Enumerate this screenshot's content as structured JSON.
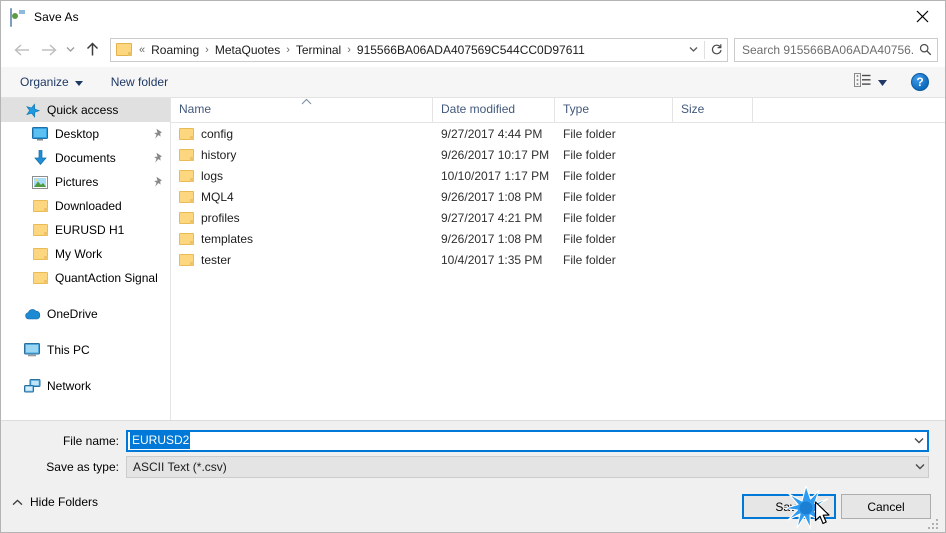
{
  "window": {
    "title": "Save As",
    "app_icon": "save-as-app-icon",
    "close_label": "✕"
  },
  "nav": {
    "back_tooltip": "Back",
    "forward_tooltip": "Forward",
    "recent_tooltip": "Recent locations",
    "up_tooltip": "Up",
    "breadcrumb_prefix": "«",
    "breadcrumbs": [
      {
        "label": "Roaming"
      },
      {
        "label": "MetaQuotes"
      },
      {
        "label": "Terminal"
      },
      {
        "label": "915566BA06ADA407569C544CC0D97611"
      }
    ],
    "separator": "›",
    "refresh_tooltip": "Refresh"
  },
  "search": {
    "placeholder": "Search 915566BA06ADA40756...",
    "value": ""
  },
  "toolbar": {
    "organize_label": "Organize",
    "new_folder_label": "New folder",
    "view_mode_label": "Change your view",
    "help_label": "?"
  },
  "sidebar": {
    "items": [
      {
        "label": "Quick access",
        "icon": "star-icon",
        "selected": true,
        "pinned": false,
        "indent": false
      },
      {
        "label": "Desktop",
        "icon": "desktop-icon",
        "selected": false,
        "pinned": true,
        "indent": true
      },
      {
        "label": "Documents",
        "icon": "documents-download-icon",
        "selected": false,
        "pinned": true,
        "indent": true
      },
      {
        "label": "Pictures",
        "icon": "pictures-icon",
        "selected": false,
        "pinned": true,
        "indent": true
      },
      {
        "label": "Downloaded",
        "icon": "folder-icon",
        "selected": false,
        "pinned": false,
        "indent": true
      },
      {
        "label": "EURUSD H1",
        "icon": "folder-icon",
        "selected": false,
        "pinned": false,
        "indent": true
      },
      {
        "label": "My Work",
        "icon": "folder-icon",
        "selected": false,
        "pinned": false,
        "indent": true
      },
      {
        "label": "QuantAction Signal",
        "icon": "folder-icon",
        "selected": false,
        "pinned": false,
        "indent": true
      },
      {
        "label": "OneDrive",
        "icon": "onedrive-cloud-icon",
        "selected": false,
        "pinned": false,
        "indent": false,
        "gap_before": true
      },
      {
        "label": "This PC",
        "icon": "this-pc-icon",
        "selected": false,
        "pinned": false,
        "indent": false,
        "gap_before": true
      },
      {
        "label": "Network",
        "icon": "network-icon",
        "selected": false,
        "pinned": false,
        "indent": false,
        "gap_before": true
      }
    ]
  },
  "filelist": {
    "columns": [
      {
        "label": "Name",
        "key": "name"
      },
      {
        "label": "Date modified",
        "key": "date"
      },
      {
        "label": "Type",
        "key": "type"
      },
      {
        "label": "Size",
        "key": "size"
      }
    ],
    "sort_column": "Name",
    "sort_direction": "ascending",
    "rows": [
      {
        "name": "config",
        "date": "9/27/2017 4:44 PM",
        "type": "File folder",
        "size": ""
      },
      {
        "name": "history",
        "date": "9/26/2017 10:17 PM",
        "type": "File folder",
        "size": ""
      },
      {
        "name": "logs",
        "date": "10/10/2017 1:17 PM",
        "type": "File folder",
        "size": ""
      },
      {
        "name": "MQL4",
        "date": "9/26/2017 1:08 PM",
        "type": "File folder",
        "size": ""
      },
      {
        "name": "profiles",
        "date": "9/27/2017 4:21 PM",
        "type": "File folder",
        "size": ""
      },
      {
        "name": "templates",
        "date": "9/26/2017 1:08 PM",
        "type": "File folder",
        "size": ""
      },
      {
        "name": "tester",
        "date": "10/4/2017 1:35 PM",
        "type": "File folder",
        "size": ""
      }
    ]
  },
  "form": {
    "filename_label": "File name:",
    "filename_value": "EURUSD2",
    "filetype_label": "Save as type:",
    "filetype_value": "ASCII Text (*.csv)"
  },
  "footer": {
    "hide_folders_label": "Hide Folders",
    "save_label": "Save",
    "cancel_label": "Cancel"
  },
  "colors": {
    "accent": "#0078d7",
    "folder": "#fcd77f",
    "column_header_text": "#42597c",
    "toolbar_text": "#1f3864",
    "dialog_bg": "#f0f0f0"
  }
}
